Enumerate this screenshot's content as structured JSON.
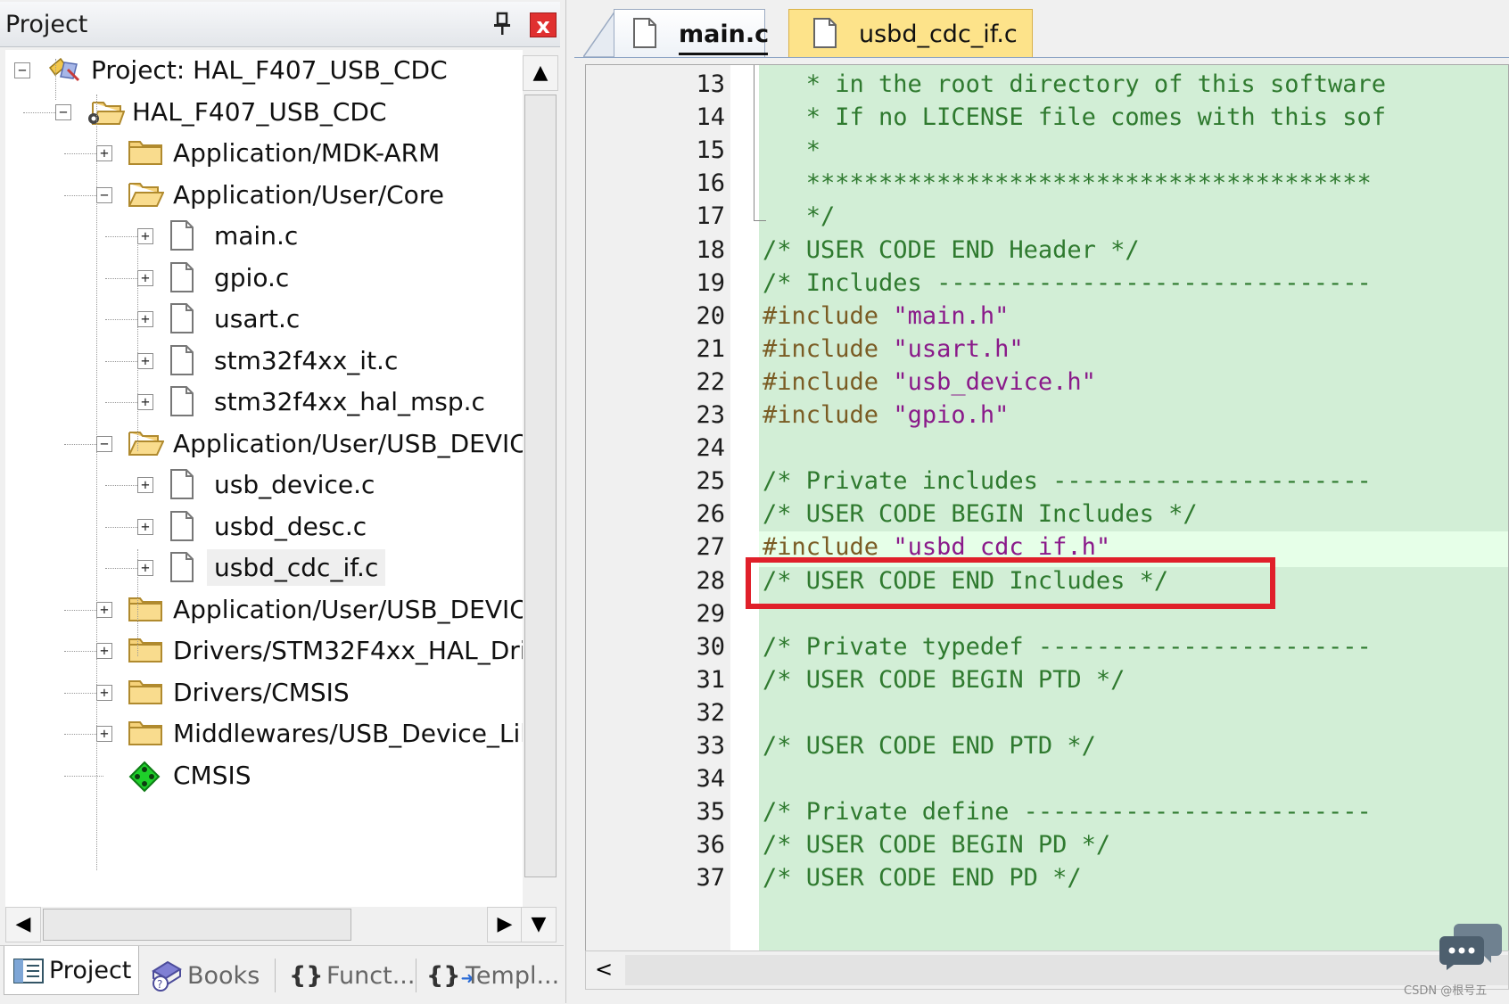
{
  "project_pane": {
    "title": "Project",
    "pin_icon": "pin-icon",
    "close_label": "x",
    "tree": [
      {
        "id": "project-root",
        "label": "Project: HAL_F407_USB_CDC",
        "level": 0,
        "expander": "−",
        "icon": "project-icon"
      },
      {
        "id": "target",
        "label": "HAL_F407_USB_CDC",
        "level": 1,
        "expander": "−",
        "icon": "target-folder-icon"
      },
      {
        "id": "grp-mdk",
        "label": "Application/MDK-ARM",
        "level": 2,
        "expander": "+",
        "icon": "folder-icon"
      },
      {
        "id": "grp-core",
        "label": "Application/User/Core",
        "level": 2,
        "expander": "−",
        "icon": "folder-open-icon"
      },
      {
        "id": "file-main",
        "label": "main.c",
        "level": 3,
        "expander": "+",
        "icon": "file-icon"
      },
      {
        "id": "file-gpio",
        "label": "gpio.c",
        "level": 3,
        "expander": "+",
        "icon": "file-icon"
      },
      {
        "id": "file-usart",
        "label": "usart.c",
        "level": 3,
        "expander": "+",
        "icon": "file-icon"
      },
      {
        "id": "file-it",
        "label": "stm32f4xx_it.c",
        "level": 3,
        "expander": "+",
        "icon": "file-icon"
      },
      {
        "id": "file-msp",
        "label": "stm32f4xx_hal_msp.c",
        "level": 3,
        "expander": "+",
        "icon": "file-icon"
      },
      {
        "id": "grp-usbdev1",
        "label": "Application/User/USB_DEVIC",
        "level": 2,
        "expander": "−",
        "icon": "folder-open-icon"
      },
      {
        "id": "file-usbdev",
        "label": "usb_device.c",
        "level": 3,
        "expander": "+",
        "icon": "file-icon"
      },
      {
        "id": "file-desc",
        "label": "usbd_desc.c",
        "level": 3,
        "expander": "+",
        "icon": "file-icon"
      },
      {
        "id": "file-cdcif",
        "label": "usbd_cdc_if.c",
        "level": 3,
        "expander": "+",
        "icon": "file-icon",
        "selected": true
      },
      {
        "id": "grp-usbdev2",
        "label": "Application/User/USB_DEVIC",
        "level": 2,
        "expander": "+",
        "icon": "folder-icon"
      },
      {
        "id": "grp-drivers",
        "label": "Drivers/STM32F4xx_HAL_Dri",
        "level": 2,
        "expander": "+",
        "icon": "folder-icon"
      },
      {
        "id": "grp-cmsis",
        "label": "Drivers/CMSIS",
        "level": 2,
        "expander": "+",
        "icon": "folder-icon"
      },
      {
        "id": "grp-mw",
        "label": "Middlewares/USB_Device_Lil",
        "level": 2,
        "expander": "+",
        "icon": "folder-icon"
      },
      {
        "id": "cmsis",
        "label": "CMSIS",
        "level": 2,
        "expander": "",
        "icon": "cmsis-diamond-icon"
      }
    ],
    "bottom_tabs": [
      {
        "id": "project",
        "label": "Project",
        "icon": "project-tab-icon",
        "active": true
      },
      {
        "id": "books",
        "label": "Books",
        "icon": "books-icon",
        "active": false
      },
      {
        "id": "functions",
        "label": "Funct...",
        "icon": "braces-icon",
        "active": false
      },
      {
        "id": "templates",
        "label": "Templ...",
        "icon": "template-icon",
        "active": false
      }
    ]
  },
  "editor": {
    "tabs": [
      {
        "id": "main",
        "label": "main.c",
        "active": true
      },
      {
        "id": "cdc",
        "label": "usbd_cdc_if.c",
        "active": false
      }
    ],
    "current_line": 27,
    "highlighted_line": 27,
    "lines": [
      {
        "n": "13",
        "segments": [
          {
            "t": "   * in the root directory of this software",
            "c": "comment"
          }
        ]
      },
      {
        "n": "14",
        "segments": [
          {
            "t": "   * If no LICENSE file comes with this sof",
            "c": "comment"
          }
        ]
      },
      {
        "n": "15",
        "segments": [
          {
            "t": "   *",
            "c": "comment"
          }
        ]
      },
      {
        "n": "16",
        "segments": [
          {
            "t": "   ***************************************",
            "c": "comment"
          }
        ]
      },
      {
        "n": "17",
        "segments": [
          {
            "t": "   */",
            "c": "comment"
          }
        ]
      },
      {
        "n": "18",
        "segments": [
          {
            "t": "/* USER CODE END Header */",
            "c": "comment"
          }
        ]
      },
      {
        "n": "19",
        "segments": [
          {
            "t": "/* Includes ------------------------------",
            "c": "comment"
          }
        ]
      },
      {
        "n": "20",
        "segments": [
          {
            "t": "#include ",
            "c": "pre"
          },
          {
            "t": "\"main.h\"",
            "c": "str"
          }
        ]
      },
      {
        "n": "21",
        "segments": [
          {
            "t": "#include ",
            "c": "pre"
          },
          {
            "t": "\"usart.h\"",
            "c": "str"
          }
        ]
      },
      {
        "n": "22",
        "segments": [
          {
            "t": "#include ",
            "c": "pre"
          },
          {
            "t": "\"usb_device.h\"",
            "c": "str"
          }
        ]
      },
      {
        "n": "23",
        "segments": [
          {
            "t": "#include ",
            "c": "pre"
          },
          {
            "t": "\"gpio.h\"",
            "c": "str"
          }
        ]
      },
      {
        "n": "24",
        "segments": []
      },
      {
        "n": "25",
        "segments": [
          {
            "t": "/* Private includes ----------------------",
            "c": "comment"
          }
        ]
      },
      {
        "n": "26",
        "segments": [
          {
            "t": "/* USER CODE BEGIN Includes */",
            "c": "comment"
          }
        ]
      },
      {
        "n": "27",
        "segments": [
          {
            "t": "#include ",
            "c": "pre"
          },
          {
            "t": "\"usbd_cdc_if.h\"",
            "c": "str"
          }
        ]
      },
      {
        "n": "28",
        "segments": [
          {
            "t": "/* USER CODE END Includes */",
            "c": "comment"
          }
        ]
      },
      {
        "n": "29",
        "segments": []
      },
      {
        "n": "30",
        "segments": [
          {
            "t": "/* Private typedef -----------------------",
            "c": "comment"
          }
        ]
      },
      {
        "n": "31",
        "segments": [
          {
            "t": "/* USER CODE BEGIN PTD */",
            "c": "comment"
          }
        ]
      },
      {
        "n": "32",
        "segments": []
      },
      {
        "n": "33",
        "segments": [
          {
            "t": "/* USER CODE END PTD */",
            "c": "comment"
          }
        ]
      },
      {
        "n": "34",
        "segments": []
      },
      {
        "n": "35",
        "segments": [
          {
            "t": "/* Private define ------------------------",
            "c": "comment"
          }
        ]
      },
      {
        "n": "36",
        "segments": [
          {
            "t": "/* USER CODE BEGIN PD */",
            "c": "comment"
          }
        ]
      },
      {
        "n": "37",
        "segments": [
          {
            "t": "/* USER CODE END PD */",
            "c": "comment"
          }
        ]
      }
    ],
    "hscroll_left": "<"
  },
  "watermark": "CSDN @根号五",
  "colors": {
    "code_background": "#d2eed6",
    "comment": "#2f7a2f",
    "preprocessor": "#7a5c24",
    "string": "#8a1a8a",
    "highlight_box": "#e0202a",
    "active_tab_yellow": "#fde38a"
  }
}
